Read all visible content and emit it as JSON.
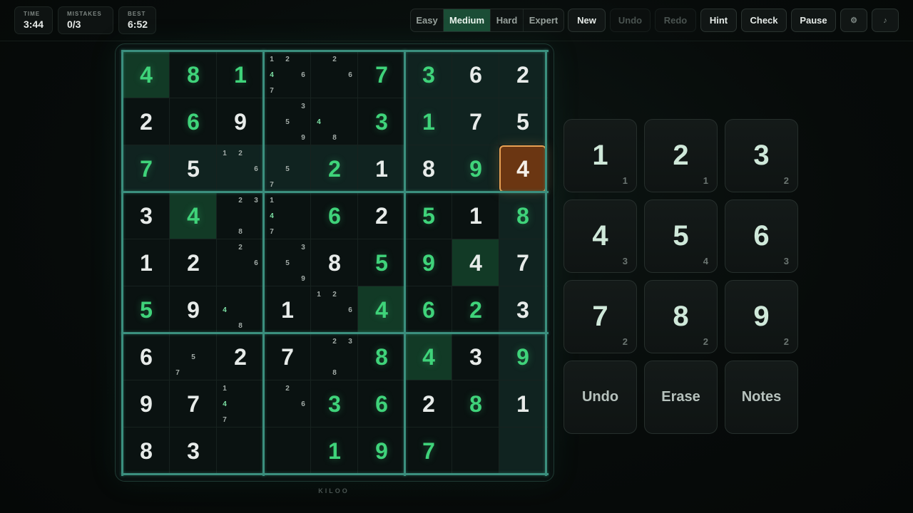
{
  "stats": {
    "time_label": "TIME",
    "time_value": "3:44",
    "mistakes_label": "MISTAKES",
    "mistakes_value": "0/3",
    "best_label": "BEST",
    "best_value": "6:52"
  },
  "difficulty": {
    "options": [
      "Easy",
      "Medium",
      "Hard",
      "Expert"
    ],
    "selected": "Medium"
  },
  "toolbar": {
    "new_label": "New",
    "undo_label": "Undo",
    "redo_label": "Redo",
    "hint_label": "Hint",
    "check_label": "Check",
    "pause_label": "Pause",
    "settings_icon": "gear-icon",
    "sound_icon": "music-note-icon"
  },
  "board": {
    "selected": [
      2,
      8
    ],
    "rows": [
      [
        {
          "v": "4",
          "t": "u"
        },
        {
          "v": "8",
          "t": "u"
        },
        {
          "v": "1",
          "t": "u"
        },
        {
          "n": [
            1,
            2,
            4,
            6,
            7
          ]
        },
        {
          "n": [
            2,
            6
          ]
        },
        {
          "v": "7",
          "t": "u"
        },
        {
          "v": "3",
          "t": "u"
        },
        {
          "v": "6",
          "t": "g"
        },
        {
          "v": "2",
          "t": "g"
        }
      ],
      [
        {
          "v": "2",
          "t": "g"
        },
        {
          "v": "6",
          "t": "u"
        },
        {
          "v": "9",
          "t": "g"
        },
        {
          "n": [
            3,
            5,
            9
          ]
        },
        {
          "n": [
            4,
            8
          ]
        },
        {
          "v": "3",
          "t": "u"
        },
        {
          "v": "1",
          "t": "u"
        },
        {
          "v": "7",
          "t": "g"
        },
        {
          "v": "5",
          "t": "g"
        }
      ],
      [
        {
          "v": "7",
          "t": "u"
        },
        {
          "v": "5",
          "t": "g"
        },
        {
          "n": [
            1,
            2,
            6
          ]
        },
        {
          "n": [
            5,
            7
          ]
        },
        {
          "v": "2",
          "t": "u"
        },
        {
          "v": "1",
          "t": "g"
        },
        {
          "v": "8",
          "t": "g"
        },
        {
          "v": "9",
          "t": "u"
        },
        {
          "v": "4",
          "t": "g"
        }
      ],
      [
        {
          "v": "3",
          "t": "g"
        },
        {
          "v": "4",
          "t": "u"
        },
        {
          "n": [
            2,
            3,
            8
          ]
        },
        {
          "n": [
            1,
            4,
            7
          ]
        },
        {
          "v": "6",
          "t": "u"
        },
        {
          "v": "2",
          "t": "g"
        },
        {
          "v": "5",
          "t": "u"
        },
        {
          "v": "1",
          "t": "g"
        },
        {
          "v": "8",
          "t": "u"
        }
      ],
      [
        {
          "v": "1",
          "t": "g"
        },
        {
          "v": "2",
          "t": "g"
        },
        {
          "n": [
            2,
            6
          ]
        },
        {
          "n": [
            3,
            5,
            9
          ]
        },
        {
          "v": "8",
          "t": "g"
        },
        {
          "v": "5",
          "t": "u"
        },
        {
          "v": "9",
          "t": "u"
        },
        {
          "v": "4",
          "t": "g"
        },
        {
          "v": "7",
          "t": "g"
        }
      ],
      [
        {
          "v": "5",
          "t": "u"
        },
        {
          "v": "9",
          "t": "g"
        },
        {
          "n": [
            4,
            8
          ]
        },
        {
          "v": "1",
          "t": "g"
        },
        {
          "n": [
            1,
            2,
            6
          ]
        },
        {
          "v": "4",
          "t": "u"
        },
        {
          "v": "6",
          "t": "u"
        },
        {
          "v": "2",
          "t": "u"
        },
        {
          "v": "3",
          "t": "g"
        }
      ],
      [
        {
          "v": "6",
          "t": "g"
        },
        {
          "n": [
            5,
            7
          ]
        },
        {
          "v": "2",
          "t": "g"
        },
        {
          "v": "7",
          "t": "g"
        },
        {
          "n": [
            2,
            3,
            8
          ]
        },
        {
          "v": "8",
          "t": "u"
        },
        {
          "v": "4",
          "t": "u"
        },
        {
          "v": "3",
          "t": "g"
        },
        {
          "v": "9",
          "t": "u"
        }
      ],
      [
        {
          "v": "9",
          "t": "g"
        },
        {
          "v": "7",
          "t": "g"
        },
        {
          "n": [
            1,
            4,
            7
          ]
        },
        {
          "n": [
            2,
            6
          ]
        },
        {
          "v": "3",
          "t": "u"
        },
        {
          "v": "6",
          "t": "u"
        },
        {
          "v": "2",
          "t": "g"
        },
        {
          "v": "8",
          "t": "u"
        },
        {
          "v": "1",
          "t": "g"
        }
      ],
      [
        {
          "v": "8",
          "t": "g"
        },
        {
          "v": "3",
          "t": "g"
        },
        {},
        {},
        {
          "v": "1",
          "t": "u"
        },
        {
          "v": "9",
          "t": "u"
        },
        {
          "v": "7",
          "t": "u"
        },
        {},
        {}
      ]
    ],
    "green_cells": [
      [
        0,
        0
      ],
      [
        3,
        1
      ],
      [
        4,
        7
      ],
      [
        5,
        5
      ],
      [
        6,
        6
      ]
    ]
  },
  "brand": "KILOO",
  "pad": {
    "digits": [
      {
        "digit": "1",
        "remaining": "1"
      },
      {
        "digit": "2",
        "remaining": "1"
      },
      {
        "digit": "3",
        "remaining": "2"
      },
      {
        "digit": "4",
        "remaining": "3"
      },
      {
        "digit": "5",
        "remaining": "4"
      },
      {
        "digit": "6",
        "remaining": "3"
      },
      {
        "digit": "7",
        "remaining": "2"
      },
      {
        "digit": "8",
        "remaining": "2"
      },
      {
        "digit": "9",
        "remaining": "2"
      }
    ],
    "undo_label": "Undo",
    "erase_label": "Erase",
    "notes_label": "Notes"
  },
  "colors": {
    "accent_green": "#3fd37a",
    "selection_orange": "#e9a254",
    "box_border": "#3b8f7e"
  }
}
